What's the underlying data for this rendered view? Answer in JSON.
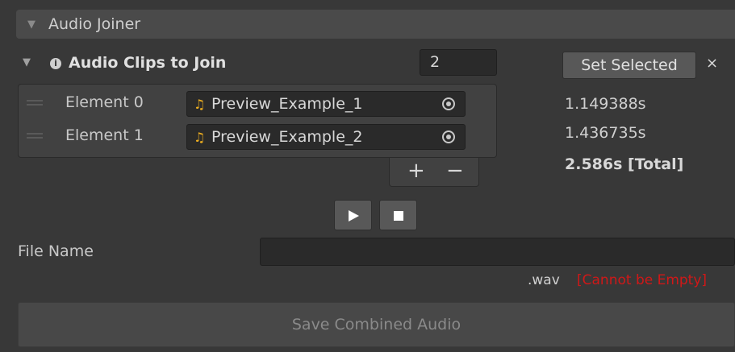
{
  "header": {
    "title": "Audio Joiner"
  },
  "clip_list": {
    "title": "Audio Clips to Join",
    "count": "2",
    "elements": [
      {
        "label": "Element 0",
        "clip": "Preview_Example_1",
        "duration": "1.149388s"
      },
      {
        "label": "Element 1",
        "clip": "Preview_Example_2",
        "duration": "1.436735s"
      }
    ],
    "add_label": "+",
    "remove_label": "−"
  },
  "side": {
    "set_selected_label": "Set Selected",
    "close_label": "×",
    "total": "2.586s [Total]"
  },
  "playback": {
    "play_icon": "play-icon",
    "stop_icon": "stop-icon"
  },
  "file": {
    "label": "File Name",
    "value": "",
    "extension": ".wav",
    "error": "[Cannot be Empty]",
    "error_color": "#d01818"
  },
  "save_label": "Save Combined Audio"
}
